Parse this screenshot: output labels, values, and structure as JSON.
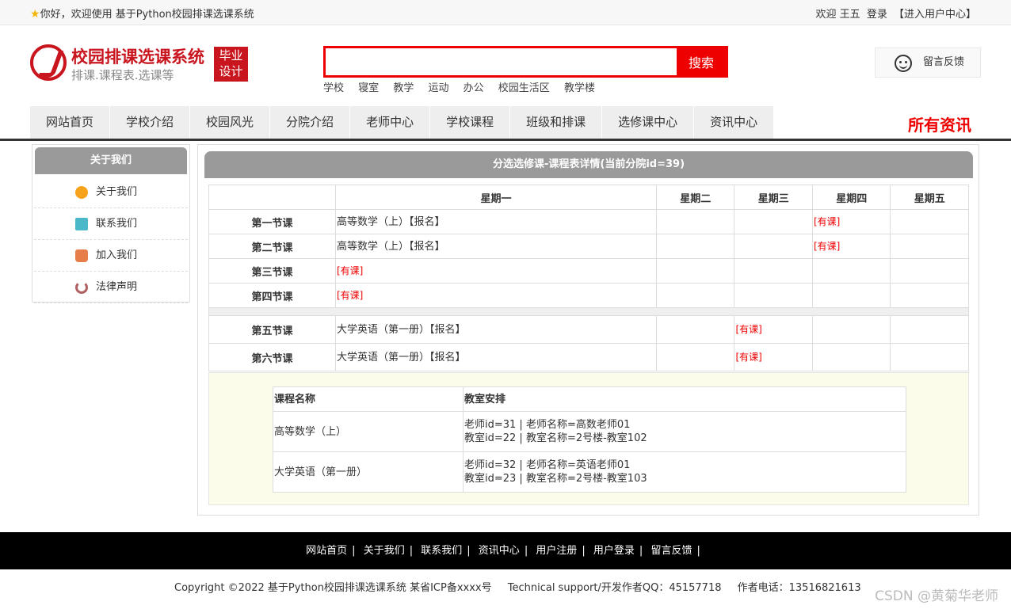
{
  "topbar": {
    "welcome": "你好，欢迎使用 基于Python校园排课选课系统",
    "user_greeting": "欢迎 王五",
    "login": "登录",
    "user_center": "【进入用户中心】"
  },
  "logo": {
    "title": "校园排课选课系统",
    "subtitle": "排课.课程表.选课等",
    "badge_line1": "毕业",
    "badge_line2": "设计"
  },
  "search": {
    "value": "",
    "button": "搜索",
    "hotwords": [
      "学校",
      "寝室",
      "教学",
      "运动",
      "办公",
      "校园生活区",
      "教学楼"
    ]
  },
  "feedback": {
    "label": "留言反馈"
  },
  "nav": {
    "items": [
      "网站首页",
      "学校介绍",
      "校园风光",
      "分院介绍",
      "老师中心",
      "学校课程",
      "班级和排课",
      "选修课中心",
      "资讯中心"
    ],
    "all_news": "所有资讯"
  },
  "sidebar": {
    "title": "关于我们",
    "items": [
      "关于我们",
      "联系我们",
      "加入我们",
      "法律声明"
    ]
  },
  "main": {
    "title": "分选选修课-课程表详情(当前分院id=39)",
    "days": [
      "星期一",
      "星期二",
      "星期三",
      "星期四",
      "星期五"
    ],
    "periods": [
      "第一节课",
      "第二节课",
      "第三节课",
      "第四节课",
      "第五节课",
      "第六节课"
    ],
    "has_class": "[有课]",
    "course_math": "高等数学（上）【报名】",
    "course_english": "大学英语（第一册）【报名】",
    "arrange_header_name": "课程名称",
    "arrange_header_room": "教室安排",
    "arrange_rows": [
      {
        "name": "高等数学（上）",
        "line1": "老师id=31 | 老师名称=高数老师01",
        "line2": "教室id=22 | 教室名称=2号楼-教室102"
      },
      {
        "name": "大学英语（第一册）",
        "line1": "老师id=32 | 老师名称=英语老师01",
        "line2": "教室id=23 | 教室名称=2号楼-教室103"
      }
    ]
  },
  "footer": {
    "links": [
      "网站首页",
      "关于我们",
      "联系我们",
      "资讯中心",
      "用户注册",
      "用户登录",
      "留言反馈"
    ],
    "separator": "|",
    "copyright": "Copyright ©2022 基于Python校园排课选课系统 某省ICP备xxxx号",
    "support": "Technical support/开发作者QQ：45157718",
    "phone": "作者电话：13516821613"
  },
  "watermark": "CSDN @黄菊华老师"
}
